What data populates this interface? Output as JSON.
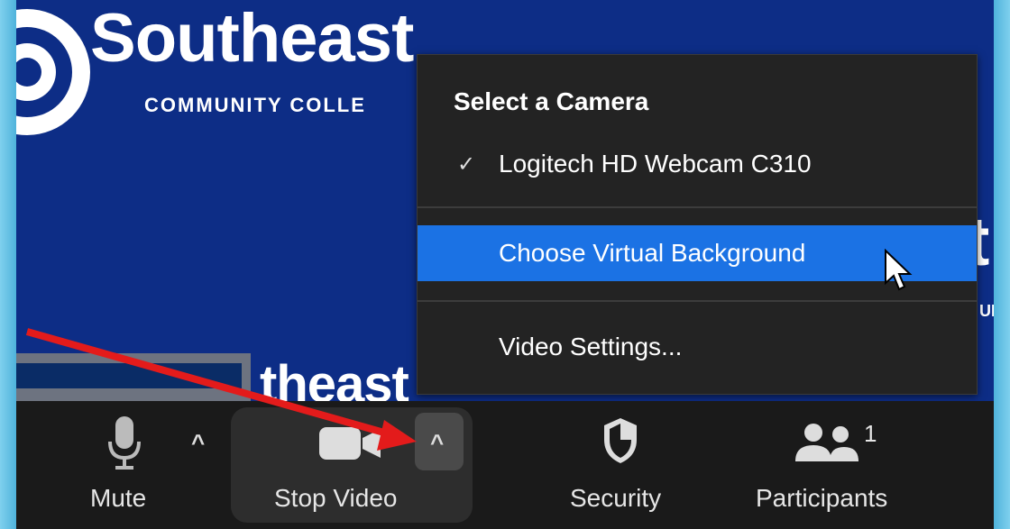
{
  "background": {
    "brand_title": "Southeast",
    "brand_subtitle": "COMMUNITY COLLE",
    "ghost_text_right": "t",
    "ghost_text_small": "UN",
    "thumbnail_text": "theast"
  },
  "menu": {
    "title": "Select a Camera",
    "items": [
      {
        "label": "Logitech HD Webcam C310",
        "checked": true,
        "check_icon": "✓"
      },
      {
        "label": "Choose Virtual Background",
        "highlighted": true
      },
      {
        "label": "Video Settings..."
      }
    ]
  },
  "toolbar": {
    "mute_label": "Mute",
    "stop_video_label": "Stop Video",
    "security_label": "Security",
    "participants_label": "Participants",
    "participants_count": "1",
    "caret_icon": "^"
  },
  "colors": {
    "menu_bg": "#232323",
    "highlight": "#1b72e4",
    "toolbar_bg": "#1a1a1a",
    "annotation_arrow": "#e31b1b",
    "video_bg": "#0d2d86"
  }
}
